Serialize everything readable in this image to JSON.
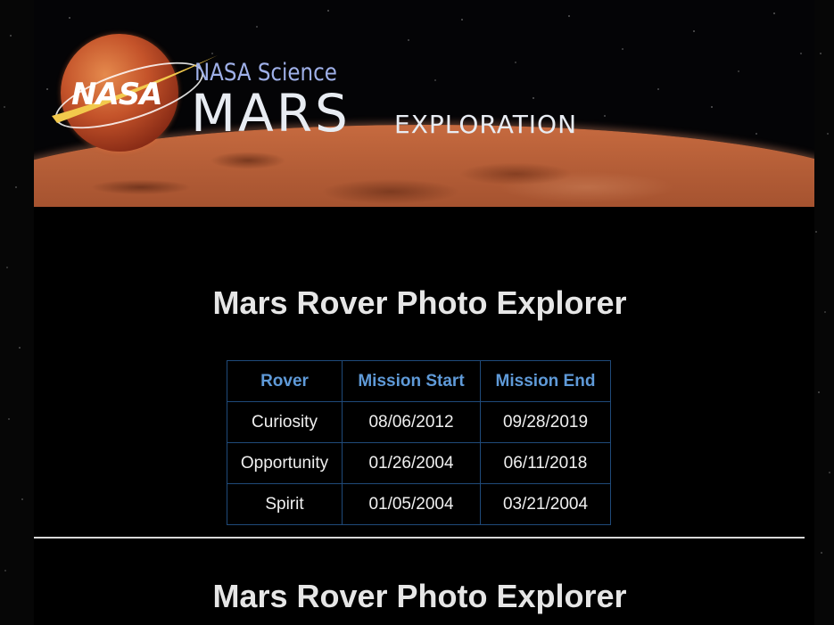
{
  "banner": {
    "agency_logo_text": "NASA",
    "subtitle": "NASA Science",
    "title": "MARS",
    "title_suffix": "EXPLORATION"
  },
  "page": {
    "heading": "Mars Rover Photo Explorer",
    "heading_repeat": "Mars Rover Photo Explorer"
  },
  "rover_table": {
    "headers": [
      "Rover",
      "Mission Start",
      "Mission End"
    ],
    "rows": [
      [
        "Curiosity",
        "08/06/2012",
        "09/28/2019"
      ],
      [
        "Opportunity",
        "01/26/2004",
        "06/11/2018"
      ],
      [
        "Spirit",
        "01/05/2004",
        "03/21/2004"
      ]
    ]
  },
  "colors": {
    "background": "#000000",
    "header_text": "#5f9ad8",
    "table_border": "#1f4a7a",
    "heading_text": "#e6e6e6",
    "subtitle_text": "#9fb0e8"
  }
}
